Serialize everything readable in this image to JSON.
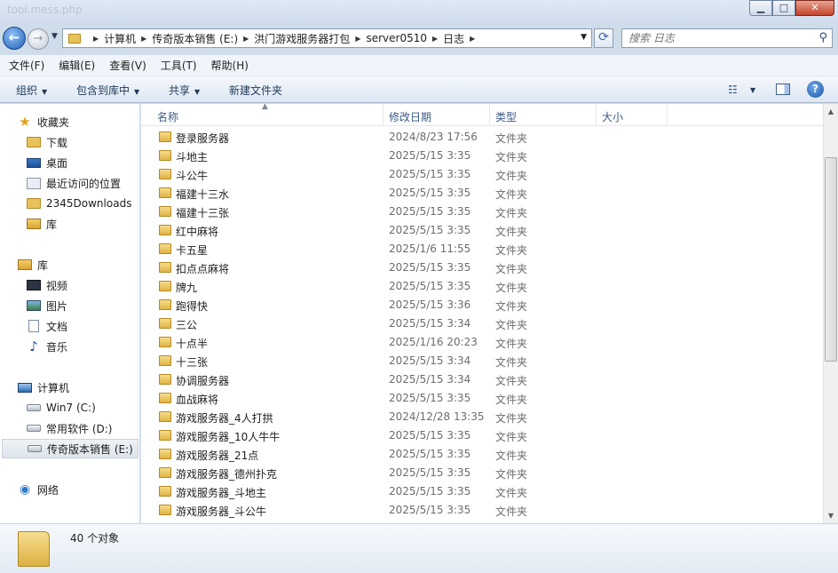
{
  "window": {
    "title": "tool.mess.php"
  },
  "address": {
    "crumbs": [
      "计算机",
      "传奇版本销售 (E:)",
      "洪门游戏服务器打包",
      "server0510",
      "日志"
    ]
  },
  "search": {
    "placeholder": "搜索 日志"
  },
  "menu": [
    "文件(F)",
    "编辑(E)",
    "查看(V)",
    "工具(T)",
    "帮助(H)"
  ],
  "toolbar": {
    "organize": "组织",
    "include": "包含到库中",
    "share": "共享",
    "new_folder": "新建文件夹"
  },
  "nav": {
    "favorites": "收藏夹",
    "fav_items": [
      "下载",
      "桌面",
      "最近访问的位置",
      "2345Downloads",
      "库"
    ],
    "libraries": "库",
    "lib_items": [
      "视频",
      "图片",
      "文档",
      "音乐"
    ],
    "computer": "计算机",
    "drives": [
      "Win7 (C:)",
      "常用软件 (D:)",
      "传奇版本销售 (E:)"
    ],
    "network": "网络"
  },
  "columns": {
    "name": "名称",
    "date": "修改日期",
    "type": "类型",
    "size": "大小"
  },
  "files": [
    {
      "name": "登录服务器",
      "date": "2024/8/23 17:56",
      "type": "文件夹"
    },
    {
      "name": "斗地主",
      "date": "2025/5/15 3:35",
      "type": "文件夹"
    },
    {
      "name": "斗公牛",
      "date": "2025/5/15 3:35",
      "type": "文件夹"
    },
    {
      "name": "福建十三水",
      "date": "2025/5/15 3:35",
      "type": "文件夹"
    },
    {
      "name": "福建十三张",
      "date": "2025/5/15 3:35",
      "type": "文件夹"
    },
    {
      "name": "红中麻将",
      "date": "2025/5/15 3:35",
      "type": "文件夹"
    },
    {
      "name": "卡五星",
      "date": "2025/1/6 11:55",
      "type": "文件夹"
    },
    {
      "name": "扣点点麻将",
      "date": "2025/5/15 3:35",
      "type": "文件夹"
    },
    {
      "name": "牌九",
      "date": "2025/5/15 3:35",
      "type": "文件夹"
    },
    {
      "name": "跑得快",
      "date": "2025/5/15 3:36",
      "type": "文件夹"
    },
    {
      "name": "三公",
      "date": "2025/5/15 3:34",
      "type": "文件夹"
    },
    {
      "name": "十点半",
      "date": "2025/1/16 20:23",
      "type": "文件夹"
    },
    {
      "name": "十三张",
      "date": "2025/5/15 3:34",
      "type": "文件夹"
    },
    {
      "name": "协调服务器",
      "date": "2025/5/15 3:34",
      "type": "文件夹"
    },
    {
      "name": "血战麻将",
      "date": "2025/5/15 3:35",
      "type": "文件夹"
    },
    {
      "name": "游戏服务器_4人打拱",
      "date": "2024/12/28 13:35",
      "type": "文件夹"
    },
    {
      "name": "游戏服务器_10人牛牛",
      "date": "2025/5/15 3:35",
      "type": "文件夹"
    },
    {
      "name": "游戏服务器_21点",
      "date": "2025/5/15 3:35",
      "type": "文件夹"
    },
    {
      "name": "游戏服务器_德州扑克",
      "date": "2025/5/15 3:35",
      "type": "文件夹"
    },
    {
      "name": "游戏服务器_斗地主",
      "date": "2025/5/15 3:35",
      "type": "文件夹"
    },
    {
      "name": "游戏服务器_斗公牛",
      "date": "2025/5/15 3:35",
      "type": "文件夹"
    }
  ],
  "status": {
    "count": "40 个对象"
  }
}
